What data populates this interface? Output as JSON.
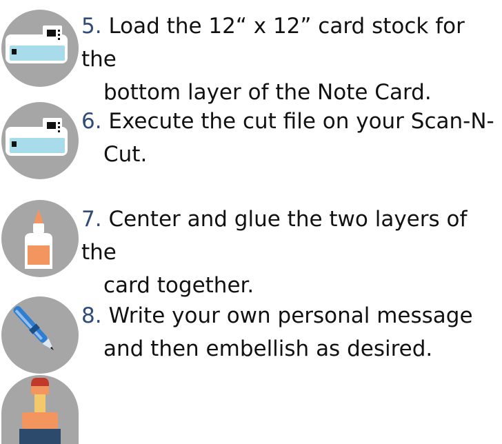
{
  "steps": [
    {
      "number": "5.",
      "text": "Load the 12“ x 12” card stock for the",
      "text2": "bottom layer of the Note Card.",
      "icon": "cutting-machine-icon"
    },
    {
      "number": "6.",
      "text": " Execute the cut file on your Scan-N-",
      "text2": "Cut.",
      "icon": "cutting-machine-icon"
    },
    {
      "number": "7.",
      "text": "Center and glue the two layers of the",
      "text2": "card together.",
      "icon": "glue-bottle-icon"
    },
    {
      "number": "8.",
      "text": "Write your own personal message",
      "text2": "and then embellish as desired.",
      "icon": "pen-icon"
    }
  ],
  "extra_icon": "stamp-icon",
  "colors": {
    "step_number": "#2e4b7c",
    "text": "#111111",
    "icon_bg": "#a6a6a6",
    "machine_blue": "#a9dcea",
    "glue_orange": "#f3955f",
    "pen_blue": "#2e7fd3"
  }
}
